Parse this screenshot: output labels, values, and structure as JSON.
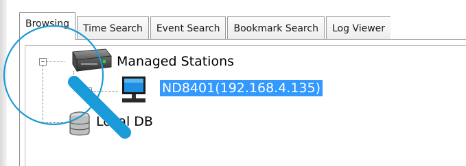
{
  "tabs": [
    {
      "label": "Browsing",
      "active": true
    },
    {
      "label": "Time Search",
      "active": false
    },
    {
      "label": "Event Search",
      "active": false
    },
    {
      "label": "Bookmark Search",
      "active": false
    },
    {
      "label": "Log Viewer",
      "active": false
    }
  ],
  "tree": {
    "root": {
      "label": "Managed Stations",
      "icon": "managed-stations-server-icon",
      "expanded": true,
      "children": [
        {
          "label": "ND8401(192.168.4.135)",
          "icon": "computer-monitor-icon",
          "selected": true,
          "expanded": false
        }
      ]
    },
    "local": {
      "label": "Local DB",
      "icon": "database-icon"
    }
  },
  "colors": {
    "selection": "#3399ff",
    "annotation": "#1a9ad8"
  }
}
